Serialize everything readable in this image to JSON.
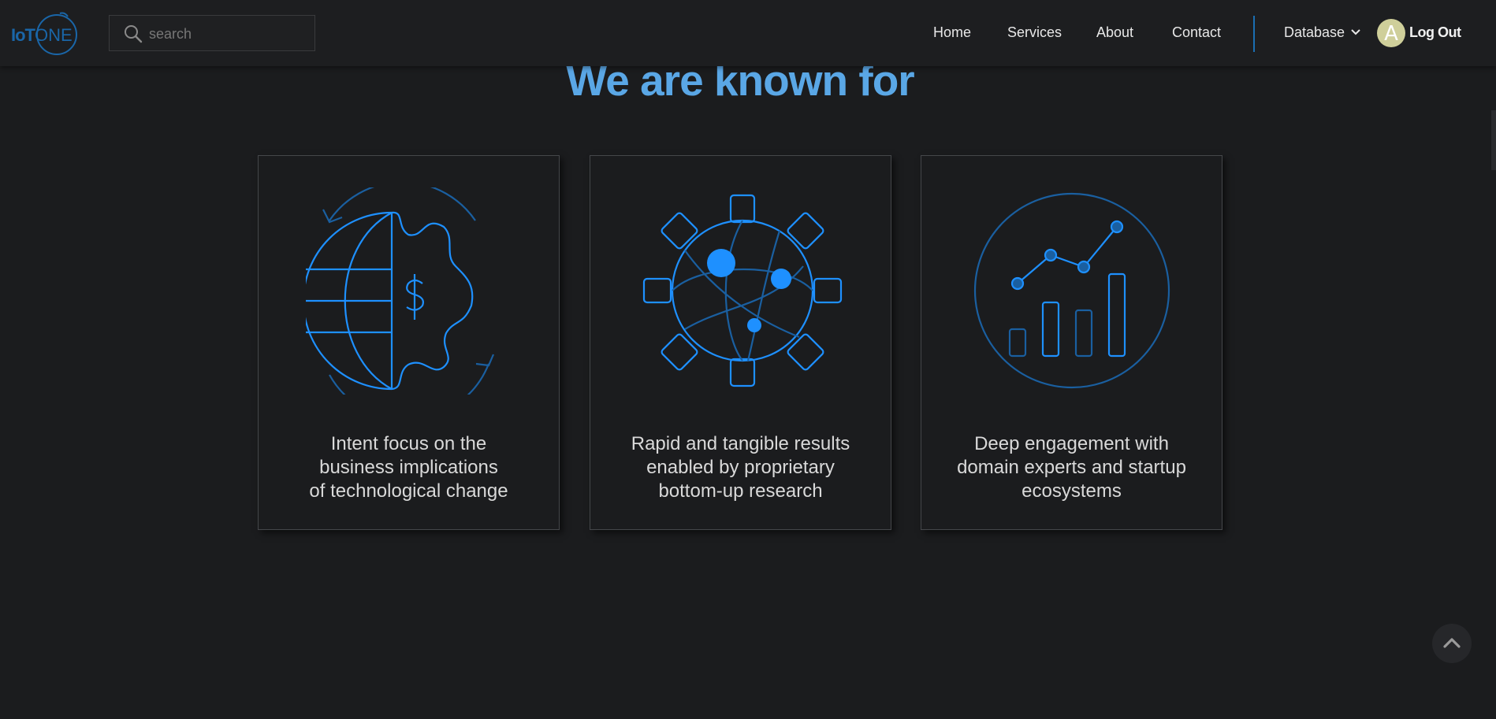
{
  "nav": {
    "logo": {
      "text_iot": "IoT",
      "text_one": "ONE"
    },
    "search": {
      "placeholder": "search",
      "value": ""
    },
    "links": [
      "Home",
      "Services",
      "About",
      "Contact"
    ],
    "database_label": "Database",
    "avatar_letter": "A",
    "logout_label": "Log Out"
  },
  "headline": "We are known for",
  "cards": [
    {
      "icon": "globe-dollar-gear-icon",
      "lines": [
        "Intent focus on the",
        "business implications",
        "of technological change"
      ]
    },
    {
      "icon": "gear-network-icon",
      "lines": [
        "Rapid and tangible results",
        "enabled by proprietary",
        "bottom-up research"
      ]
    },
    {
      "icon": "growth-chart-icon",
      "lines": [
        "Deep engagement with",
        "domain experts and startup",
        "ecosystems"
      ]
    }
  ],
  "colors": {
    "accent": "#1e90ff",
    "headline": "#5aa7e6",
    "background": "#1b1c1e"
  },
  "scroll_top_icon": "chevron-up-icon"
}
